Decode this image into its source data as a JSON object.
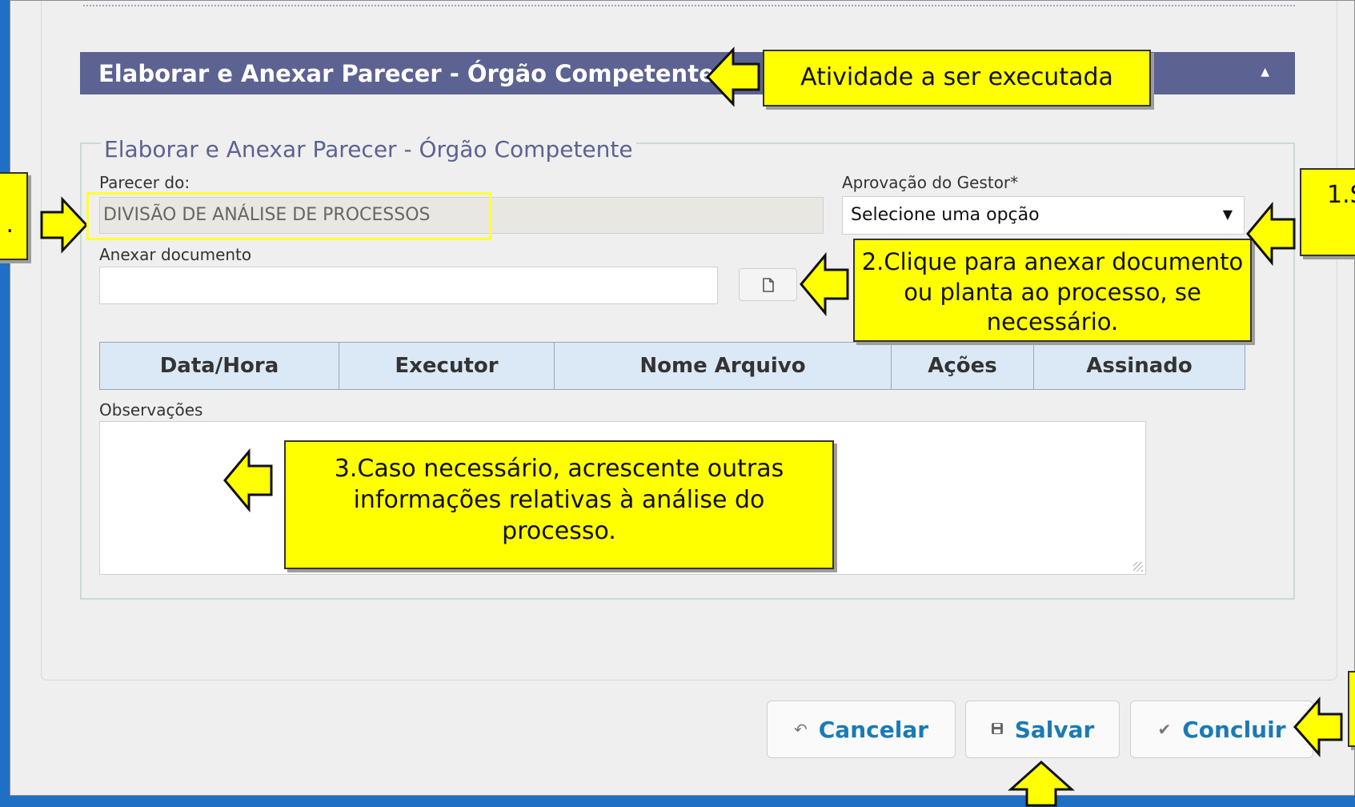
{
  "section": {
    "title": "Elaborar e Anexar Parecer - Órgão Competente",
    "legend": "Elaborar e Anexar Parecer - Órgão Competente"
  },
  "form": {
    "parecer_label": "Parecer do:",
    "parecer_value": "DIVISÃO DE ANÁLISE DE PROCESSOS",
    "aprovacao_label": "Aprovação do Gestor*",
    "aprovacao_value": "Selecione uma opção",
    "anexar_label": "Anexar documento",
    "observacoes_label": "Observações"
  },
  "table": {
    "columns": [
      "Data/Hora",
      "Executor",
      "Nome Arquivo",
      "Ações",
      "Assinado"
    ]
  },
  "buttons": {
    "cancel": "Cancelar",
    "save": "Salvar",
    "conclude": "Concluir"
  },
  "icons": {
    "collapse": "caret-up-icon",
    "dropdown": "caret-down-icon",
    "attach": "document-icon",
    "cancel": "undo-arrow-icon",
    "save": "floppy-disk-icon",
    "conclude": "checkmark-icon"
  },
  "annotations": {
    "activity": "Atividade a ser executada",
    "step1_partial": "1.S",
    "step2": "2.Clique para anexar documento ou planta ao processo, se necessário.",
    "step3": "3.Caso necessário, acrescente outras informações relativas à análise do processo.",
    "left_partial": "."
  },
  "colors": {
    "background": "#1f6fc4",
    "header": "#5c6292",
    "callout": "#ffff00",
    "button_text": "#1b7ab5",
    "table_header": "#dbe8f6"
  }
}
